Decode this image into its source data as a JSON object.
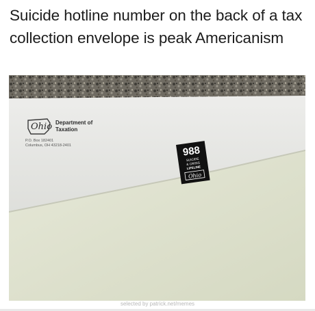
{
  "post": {
    "caption": "Suicide hotline number on the back of a tax collection envelope is peak Americanism"
  },
  "envelope": {
    "logo_script": "Ohio",
    "department_line1": "Department of",
    "department_line2": "Taxation",
    "address_line1": "P.O. Box 182401",
    "address_line2": "Columbus, OH 43218-2401"
  },
  "lifeline_badge": {
    "number": "988",
    "line1": "SUICIDE",
    "line2": "& CRISIS",
    "line3": "LIFELINE",
    "logo_script": "Ohio"
  },
  "watermark": "selected by patrick.net/memes",
  "colors": {
    "countertop": "#6b6860",
    "envelope_flap": "#e8e8e4",
    "envelope_body": "#dfe2cf",
    "badge_background": "#111111"
  }
}
